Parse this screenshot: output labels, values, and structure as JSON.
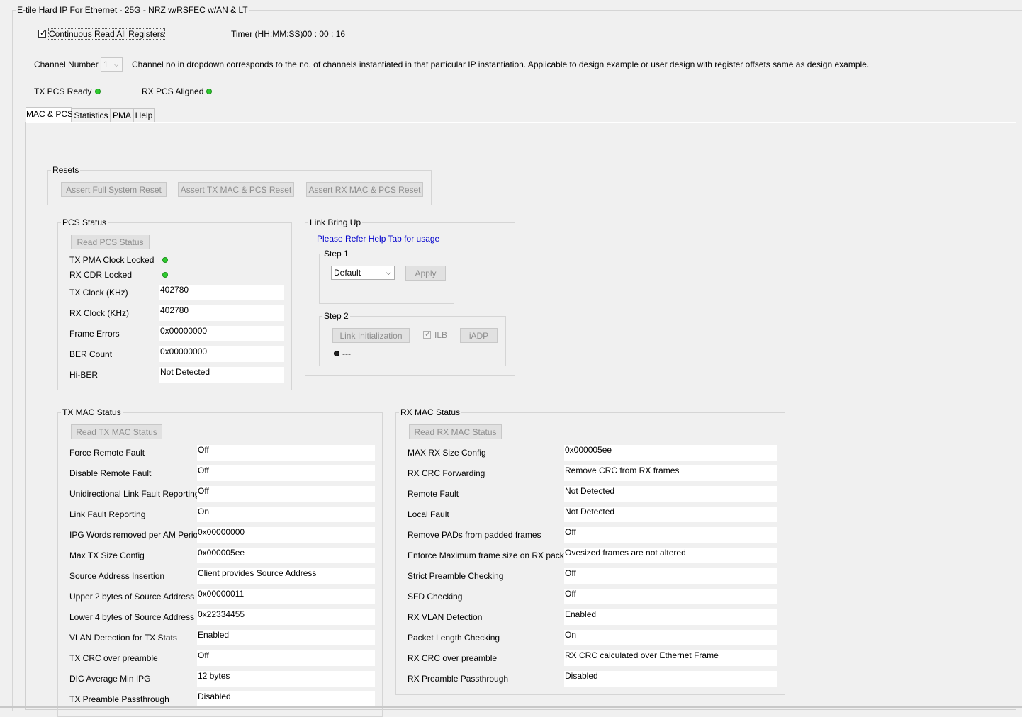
{
  "window": {
    "title": "E-tile Hard IP For Ethernet - 25G - NRZ w/RSFEC w/AN & LT"
  },
  "top": {
    "continuous_read_label": "Continuous Read All Registers",
    "timer_label": "Timer (HH:MM:SS)",
    "timer_value": "00 : 00 : 16",
    "channel_label": "Channel Number",
    "channel_value": "1",
    "channel_note": "Channel no in dropdown corresponds to the no. of channels instantiated in that particular IP instantiation. Applicable to design example or user design with register offsets same as design example.",
    "tx_pcs_ready_label": "TX PCS Ready",
    "rx_pcs_aligned_label": "RX PCS Aligned"
  },
  "tabs": [
    {
      "label": "MAC & PCS"
    },
    {
      "label": "Statistics"
    },
    {
      "label": "PMA"
    },
    {
      "label": "Help"
    }
  ],
  "resets": {
    "title": "Resets",
    "buttons": [
      "Assert Full System Reset",
      "Assert TX MAC & PCS Reset",
      "Assert RX MAC & PCS Reset"
    ]
  },
  "pcs_status": {
    "title": "PCS Status",
    "read_button": "Read PCS Status",
    "tx_pma_clock_locked": "TX PMA Clock Locked",
    "rx_cdr_locked": "RX CDR Locked",
    "fields": [
      {
        "label": "TX Clock (KHz)",
        "value": "402780"
      },
      {
        "label": "RX Clock (KHz)",
        "value": "402780"
      },
      {
        "label": "Frame Errors",
        "value": "0x00000000"
      },
      {
        "label": "BER Count",
        "value": "0x00000000"
      },
      {
        "label": "Hi-BER",
        "value": "Not Detected"
      }
    ]
  },
  "link_bring_up": {
    "title": "Link Bring Up",
    "help_note": "Please Refer Help Tab for usage",
    "step1_title": "Step 1",
    "step1_select": "Default",
    "apply_button": "Apply",
    "step2_title": "Step 2",
    "link_init_button": "Link Initialization",
    "ilb_label": "ILB",
    "iadp_button": "iADP",
    "status_text": "---"
  },
  "tx_mac": {
    "title": "TX MAC Status",
    "read_button": "Read TX MAC Status",
    "fields": [
      {
        "label": "Force Remote Fault",
        "value": "Off"
      },
      {
        "label": "Disable Remote Fault",
        "value": "Off"
      },
      {
        "label": "Unidirectional Link Fault Reporting",
        "value": "Off"
      },
      {
        "label": "Link Fault Reporting",
        "value": "On"
      },
      {
        "label": "IPG Words removed per AM Period",
        "value": "0x00000000"
      },
      {
        "label": "Max TX Size Config",
        "value": "0x000005ee"
      },
      {
        "label": "Source Address Insertion",
        "value": "Client provides Source Address"
      },
      {
        "label": "Upper 2 bytes of Source Address",
        "value": "0x00000011"
      },
      {
        "label": "Lower 4 bytes of Source Address",
        "value": "0x22334455"
      },
      {
        "label": "VLAN Detection for TX Stats",
        "value": "Enabled"
      },
      {
        "label": "TX CRC over preamble",
        "value": "Off"
      },
      {
        "label": "DIC Average Min IPG",
        "value": "12 bytes"
      },
      {
        "label": "TX Preamble Passthrough",
        "value": "Disabled"
      }
    ]
  },
  "rx_mac": {
    "title": "RX MAC Status",
    "read_button": "Read RX MAC Status",
    "fields": [
      {
        "label": "MAX RX Size Config",
        "value": "0x000005ee"
      },
      {
        "label": "RX CRC Forwarding",
        "value": "Remove CRC from RX frames"
      },
      {
        "label": "Remote Fault",
        "value": "Not Detected"
      },
      {
        "label": "Local Fault",
        "value": "Not Detected"
      },
      {
        "label": "Remove PADs from padded frames",
        "value": "Off"
      },
      {
        "label": "Enforce Maximum frame size on RX packets",
        "value": "Ovesized frames are not altered"
      },
      {
        "label": "Strict Preamble Checking",
        "value": "Off"
      },
      {
        "label": "SFD Checking",
        "value": "Off"
      },
      {
        "label": "RX VLAN Detection",
        "value": "Enabled"
      },
      {
        "label": "Packet Length Checking",
        "value": "On"
      },
      {
        "label": "RX CRC over preamble",
        "value": "RX CRC calculated over Ethernet Frame"
      },
      {
        "label": "RX Preamble Passthrough",
        "value": "Disabled"
      }
    ]
  },
  "colors": {
    "led_on": "#2ecc2e",
    "link_text": "#0000cc",
    "disabled_text": "#8d8d8d"
  }
}
